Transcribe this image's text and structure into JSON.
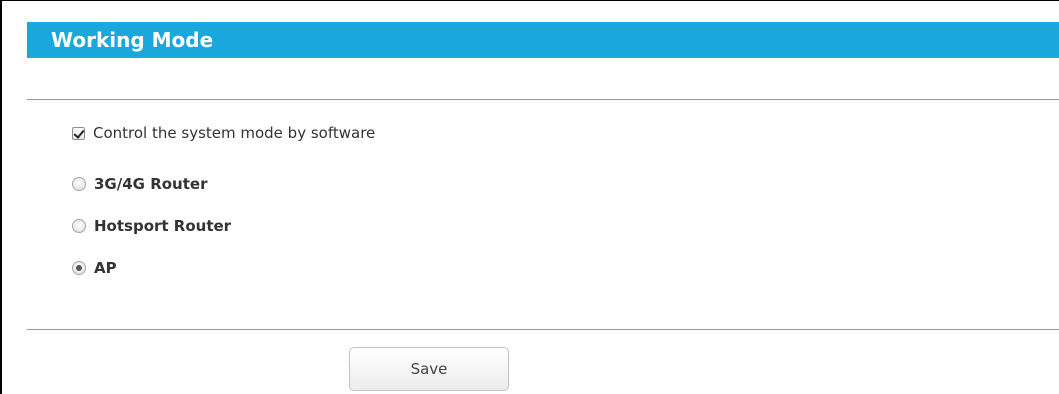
{
  "header": {
    "title": "Working Mode"
  },
  "software_control": {
    "label": "Control the system mode by software",
    "checked": true
  },
  "modes": [
    {
      "label": "3G/4G Router",
      "selected": false
    },
    {
      "label": "Hotsport Router",
      "selected": false
    },
    {
      "label": "AP",
      "selected": true
    }
  ],
  "actions": {
    "save_label": "Save"
  },
  "colors": {
    "header_bg": "#1aa7dc",
    "header_text": "#ffffff",
    "divider": "#43b5e1",
    "text": "#333333"
  },
  "icons": {
    "checkbox": "checkbox-checked-icon",
    "radio_off": "radio-unselected-icon",
    "radio_on": "radio-selected-icon"
  }
}
